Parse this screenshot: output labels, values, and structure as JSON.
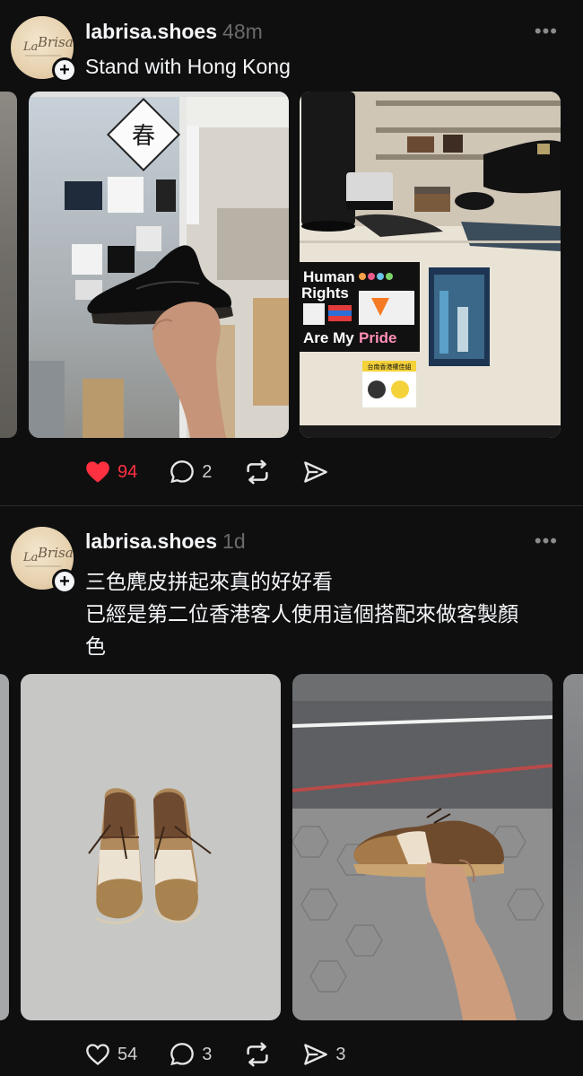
{
  "posts": [
    {
      "username": "labrisa.shoes",
      "time": "48m",
      "caption": [
        "Stand with Hong Kong"
      ],
      "media": [
        {
          "alt": "Hand holding black penny loafer in front of shop window with stickers"
        },
        {
          "alt": "Shop counter with Human Rights pride sticker and Hong Kong poster"
        }
      ],
      "sticker_text": {
        "window_char": "春",
        "line1": "Human",
        "line2": "Rights",
        "line3": "Are My",
        "line4": "Pride",
        "small_sign": "台南香港權佳組"
      },
      "likes": "94",
      "liked": true,
      "replies": "2",
      "reposts": "",
      "shares": ""
    },
    {
      "username": "labrisa.shoes",
      "time": "1d",
      "caption": [
        "三色麂皮拼起來真的好好看",
        "已經是第二位香港客人使用這個搭配來做客製顏",
        "色"
      ],
      "media": [
        {
          "alt": "Pair of tricolor suede wingtip shoes on concrete"
        },
        {
          "alt": "Hand holding tricolor suede wingtip shoe over street"
        }
      ],
      "likes": "54",
      "liked": false,
      "replies": "3",
      "reposts": "",
      "shares": "3"
    }
  ],
  "avatar_text": "La Brisa",
  "icons": {
    "heart": "heart-icon",
    "reply": "reply-icon",
    "repost": "repost-icon",
    "share": "share-icon",
    "more": "more-icon",
    "follow": "plus-icon"
  },
  "colors": {
    "background": "#0f0f10",
    "text": "#f3f5f7",
    "muted": "#6a6a6a",
    "like_red": "#ff3040"
  }
}
